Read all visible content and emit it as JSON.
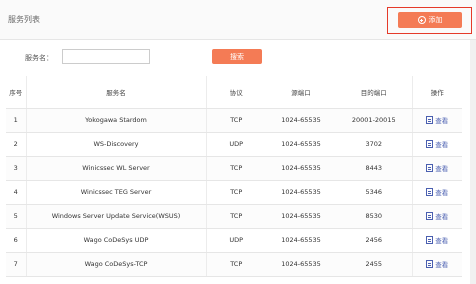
{
  "header": {
    "title": "服务列表",
    "add_label": "添加"
  },
  "search": {
    "label": "服务名：",
    "value": "",
    "button_label": "搜索"
  },
  "table": {
    "columns": [
      "序号",
      "服务名",
      "协议",
      "源端口",
      "目的端口",
      "操作"
    ],
    "rows": [
      {
        "index": "1",
        "name": "Yokogawa Stardom",
        "protocol": "TCP",
        "src_port": "1024-65535",
        "dst_port": "20001-20015",
        "action": "查看"
      },
      {
        "index": "2",
        "name": "WS-Discovery",
        "protocol": "UDP",
        "src_port": "1024-65535",
        "dst_port": "3702",
        "action": "查看"
      },
      {
        "index": "3",
        "name": "Winicssec WL Server",
        "protocol": "TCP",
        "src_port": "1024-65535",
        "dst_port": "8443",
        "action": "查看"
      },
      {
        "index": "4",
        "name": "Winicssec TEG Server",
        "protocol": "TCP",
        "src_port": "1024-65535",
        "dst_port": "5346",
        "action": "查看"
      },
      {
        "index": "5",
        "name": "Windows Server Update Service(WSUS)",
        "protocol": "TCP",
        "src_port": "1024-65535",
        "dst_port": "8530",
        "action": "查看"
      },
      {
        "index": "6",
        "name": "Wago CoDeSys UDP",
        "protocol": "UDP",
        "src_port": "1024-65535",
        "dst_port": "2456",
        "action": "查看"
      },
      {
        "index": "7",
        "name": "Wago CoDeSys-TCP",
        "protocol": "TCP",
        "src_port": "1024-65535",
        "dst_port": "2455",
        "action": "查看"
      }
    ]
  },
  "colors": {
    "accent": "#f47b55",
    "highlight_border": "#e53a2a",
    "link": "#4a5fb0"
  }
}
